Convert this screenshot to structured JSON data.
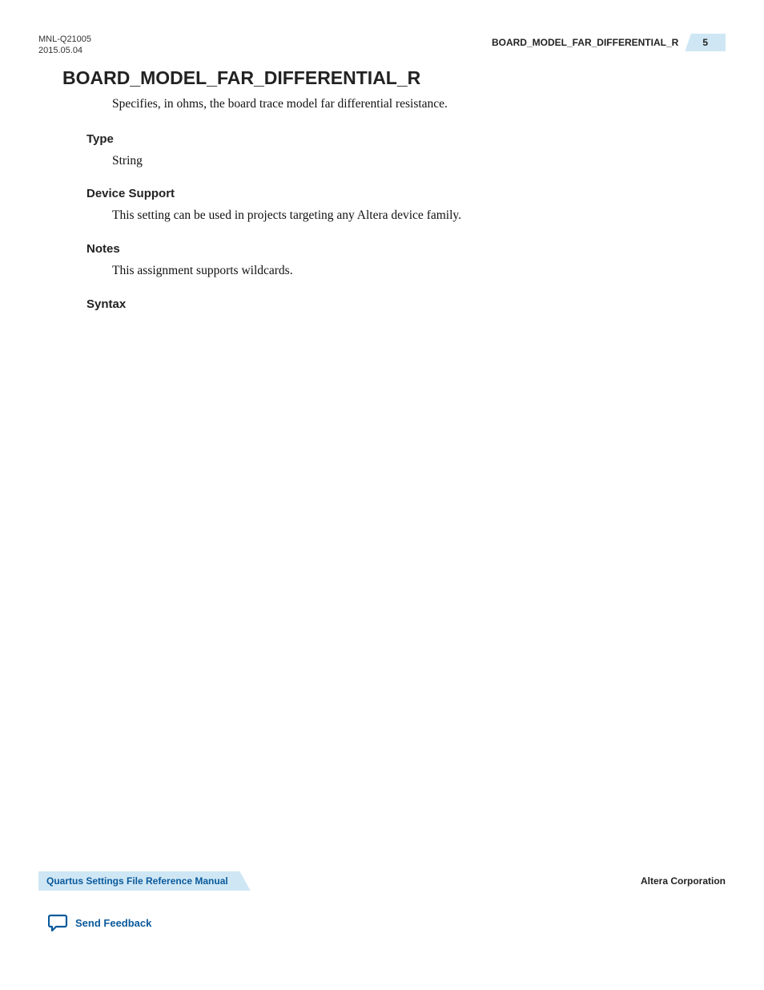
{
  "header": {
    "doc_id": "MNL-Q21005",
    "date": "2015.05.04",
    "running_title": "BOARD_MODEL_FAR_DIFFERENTIAL_R",
    "page_number": "5"
  },
  "main": {
    "heading": "BOARD_MODEL_FAR_DIFFERENTIAL_R",
    "description": "Specifies, in ohms, the board trace model far differential resistance.",
    "sections": {
      "type": {
        "label": "Type",
        "body": "String"
      },
      "device_support": {
        "label": "Device Support",
        "body": "This setting can be used in projects targeting any Altera device family."
      },
      "notes": {
        "label": "Notes",
        "body": "This assignment supports wildcards."
      },
      "syntax": {
        "label": "Syntax"
      }
    }
  },
  "footer": {
    "manual_title": "Quartus Settings File Reference Manual",
    "company": "Altera Corporation",
    "feedback_label": "Send Feedback"
  }
}
